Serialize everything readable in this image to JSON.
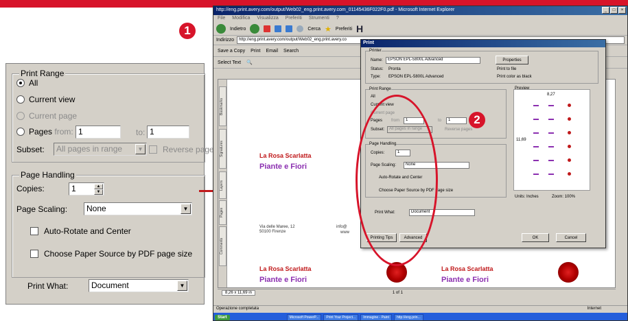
{
  "left_panel": {
    "print_range_title": "Print Range",
    "opt_all": "All",
    "opt_current_view": "Current view",
    "opt_current_page": "Current page",
    "opt_pages": "Pages",
    "from_label": "from:",
    "from_value": "1",
    "to_label": "to:",
    "to_value": "1",
    "subset_label": "Subset:",
    "subset_value": "All pages in range",
    "reverse_pages": "Reverse pages",
    "page_handling_title": "Page Handling",
    "copies_label": "Copies:",
    "copies_value": "1",
    "page_scaling_label": "Page Scaling:",
    "page_scaling_value": "None",
    "auto_rotate": "Auto-Rotate and Center",
    "choose_paper": "Choose Paper Source by PDF page size",
    "print_what_label": "Print What:",
    "print_what_value": "Document"
  },
  "badges": {
    "one": "1",
    "two": "2"
  },
  "browser": {
    "title": "http://eng.print.avery.com/output/Web02_eng.print.avery.com_01145436F022F0.pdf - Microsoft Internet Explorer",
    "menu": [
      "File",
      "Modifica",
      "Visualizza",
      "Preferiti",
      "Strumenti",
      "?"
    ],
    "nav": {
      "back": "Indietro",
      "search": "Cerca",
      "favorites": "Preferiti"
    },
    "address_label": "Indirizzo",
    "address_value": "http://eng.print.avery.com/output/Web02_eng.print.avery.co",
    "toolbar": {
      "save_copy": "Save a Copy",
      "print": "Print",
      "email": "Email",
      "search": "Search"
    },
    "toolbar2": {
      "select_text": "Select Text"
    },
    "side_tabs": [
      "Bookmarks",
      "Signatures",
      "Layers",
      "Pages",
      "Comments"
    ],
    "doc": {
      "name1": "La Rosa Scarlatta",
      "subtitle1": "Piante e Fiori",
      "address": "Via delle Maree, 12\n50100 Firenze",
      "info": "info@",
      "www": "www",
      "name2": "La Rosa Scarlatta",
      "subtitle2": "Piante e Fiori",
      "name3": "La Rosa Scarlatta",
      "subtitle3": "Piante e Fiori"
    },
    "page_size": "8,26 x 11,69 in",
    "page_nav": "1 of 1",
    "status_text": "Operazione completata",
    "status_zone": "Internet",
    "taskbar": [
      "Start",
      "Microsoft PowerP...",
      "Print Your Project...",
      "Immagine - Paint",
      "http://eng.prin..."
    ]
  },
  "print_dialog": {
    "title": "Print",
    "printer_group": "Printer",
    "name_label": "Name:",
    "name_value": "EPSON EPL-5800L Advanced",
    "status_label": "Status:",
    "status_value": "Pronta",
    "type_label": "Type:",
    "type_value": "EPSON EPL-5800L Advanced",
    "properties": "Properties",
    "print_to_file": "Print to file",
    "print_color_black": "Print color as black",
    "print_range": "Print Range",
    "all": "All",
    "current_view": "Current view",
    "current_page": "Current page",
    "pages": "Pages",
    "from": "from",
    "from_val": "1",
    "to": "to",
    "to_val": "1",
    "subset": "Subset:",
    "subset_val": "All pages in range",
    "reverse": "Reverse pages",
    "page_handling": "Page Handling",
    "copies": "Copies:",
    "copies_val": "1",
    "page_scaling": "Page Scaling:",
    "page_scaling_val": "None",
    "auto_rotate": "Auto-Rotate and Center",
    "choose_paper": "Choose Paper Source by PDF page size",
    "print_what": "Print What:",
    "print_what_val": "Document",
    "preview": "Preview",
    "width": "8,27",
    "height": "11,69",
    "units": "Units: Inches",
    "zoom": "Zoom: 100%",
    "printing_tips": "Printing Tips",
    "advanced": "Advanced",
    "ok": "OK",
    "cancel": "Cancel"
  }
}
